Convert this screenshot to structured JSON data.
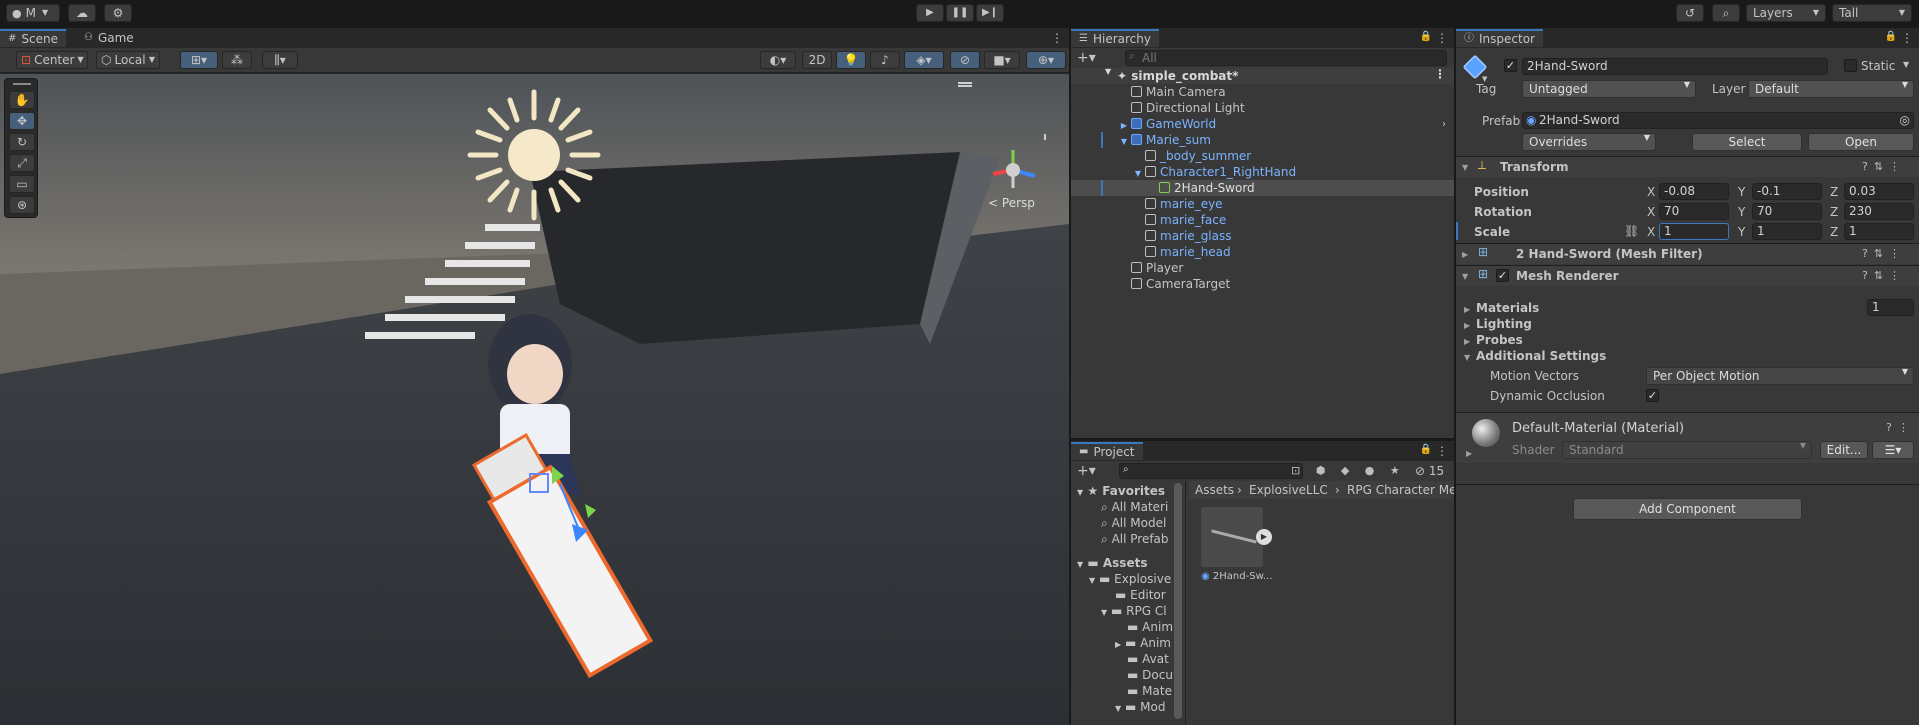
{
  "top": {
    "account": "M",
    "layers": "Layers",
    "layout": "Tall"
  },
  "tabs": {
    "scene": "Scene",
    "game": "Game",
    "hierarchy": "Hierarchy",
    "inspector": "Inspector",
    "project": "Project"
  },
  "scene_toolbar": {
    "pivot": "Center",
    "space": "Local",
    "mode2d": "2D",
    "persp": "Persp"
  },
  "hierarchy": {
    "search_placeholder": "All",
    "scene": "simple_combat*",
    "items": [
      {
        "label": "Main Camera"
      },
      {
        "label": "Directional Light"
      },
      {
        "label": "GameWorld"
      },
      {
        "label": "Marie_sum"
      },
      {
        "label": "_body_summer"
      },
      {
        "label": "Character1_RightHand"
      },
      {
        "label": "2Hand-Sword"
      },
      {
        "label": "marie_eye"
      },
      {
        "label": "marie_face"
      },
      {
        "label": "marie_glass"
      },
      {
        "label": "marie_head"
      },
      {
        "label": "Player"
      },
      {
        "label": "CameraTarget"
      }
    ]
  },
  "project": {
    "count": "15",
    "favorites": "Favorites",
    "fav_items": [
      "All Materi",
      "All Model",
      "All Prefab"
    ],
    "assets": "Assets",
    "tree": [
      "Explosive",
      "Editor",
      "RPG Cl",
      "Anim",
      "Anim",
      "Avat",
      "Docu",
      "Mate",
      "Mod"
    ],
    "breadcrumb": [
      "Assets",
      "ExplosiveLLC",
      "RPG Character Meca"
    ],
    "asset_name": "2Hand-Sw..."
  },
  "inspector": {
    "object_name": "2Hand-Sword",
    "static_label": "Static",
    "tag_label": "Tag",
    "tag_value": "Untagged",
    "layer_label": "Layer",
    "layer_value": "Default",
    "prefab_label": "Prefab",
    "prefab_value": "2Hand-Sword",
    "overrides": "Overrides",
    "select": "Select",
    "open": "Open",
    "transform": {
      "title": "Transform",
      "position_label": "Position",
      "rotation_label": "Rotation",
      "scale_label": "Scale",
      "axis_x": "X",
      "axis_y": "Y",
      "axis_z": "Z",
      "position": [
        "-0.08",
        "-0.1",
        "0.03"
      ],
      "rotation": [
        "70",
        "70",
        "230"
      ],
      "scale": [
        "1",
        "1",
        "1"
      ]
    },
    "mesh_filter": "2 Hand-Sword (Mesh Filter)",
    "mesh_renderer": {
      "title": "Mesh Renderer",
      "materials": "Materials",
      "materials_count": "1",
      "lighting": "Lighting",
      "probes": "Probes",
      "additional": "Additional Settings",
      "motion_vectors_label": "Motion Vectors",
      "motion_vectors_value": "Per Object Motion",
      "dynamic_occlusion": "Dynamic Occlusion"
    },
    "material": {
      "name": "Default-Material (Material)",
      "shader_label": "Shader",
      "shader_value": "Standard",
      "edit": "Edit..."
    },
    "add_component": "Add Component"
  }
}
